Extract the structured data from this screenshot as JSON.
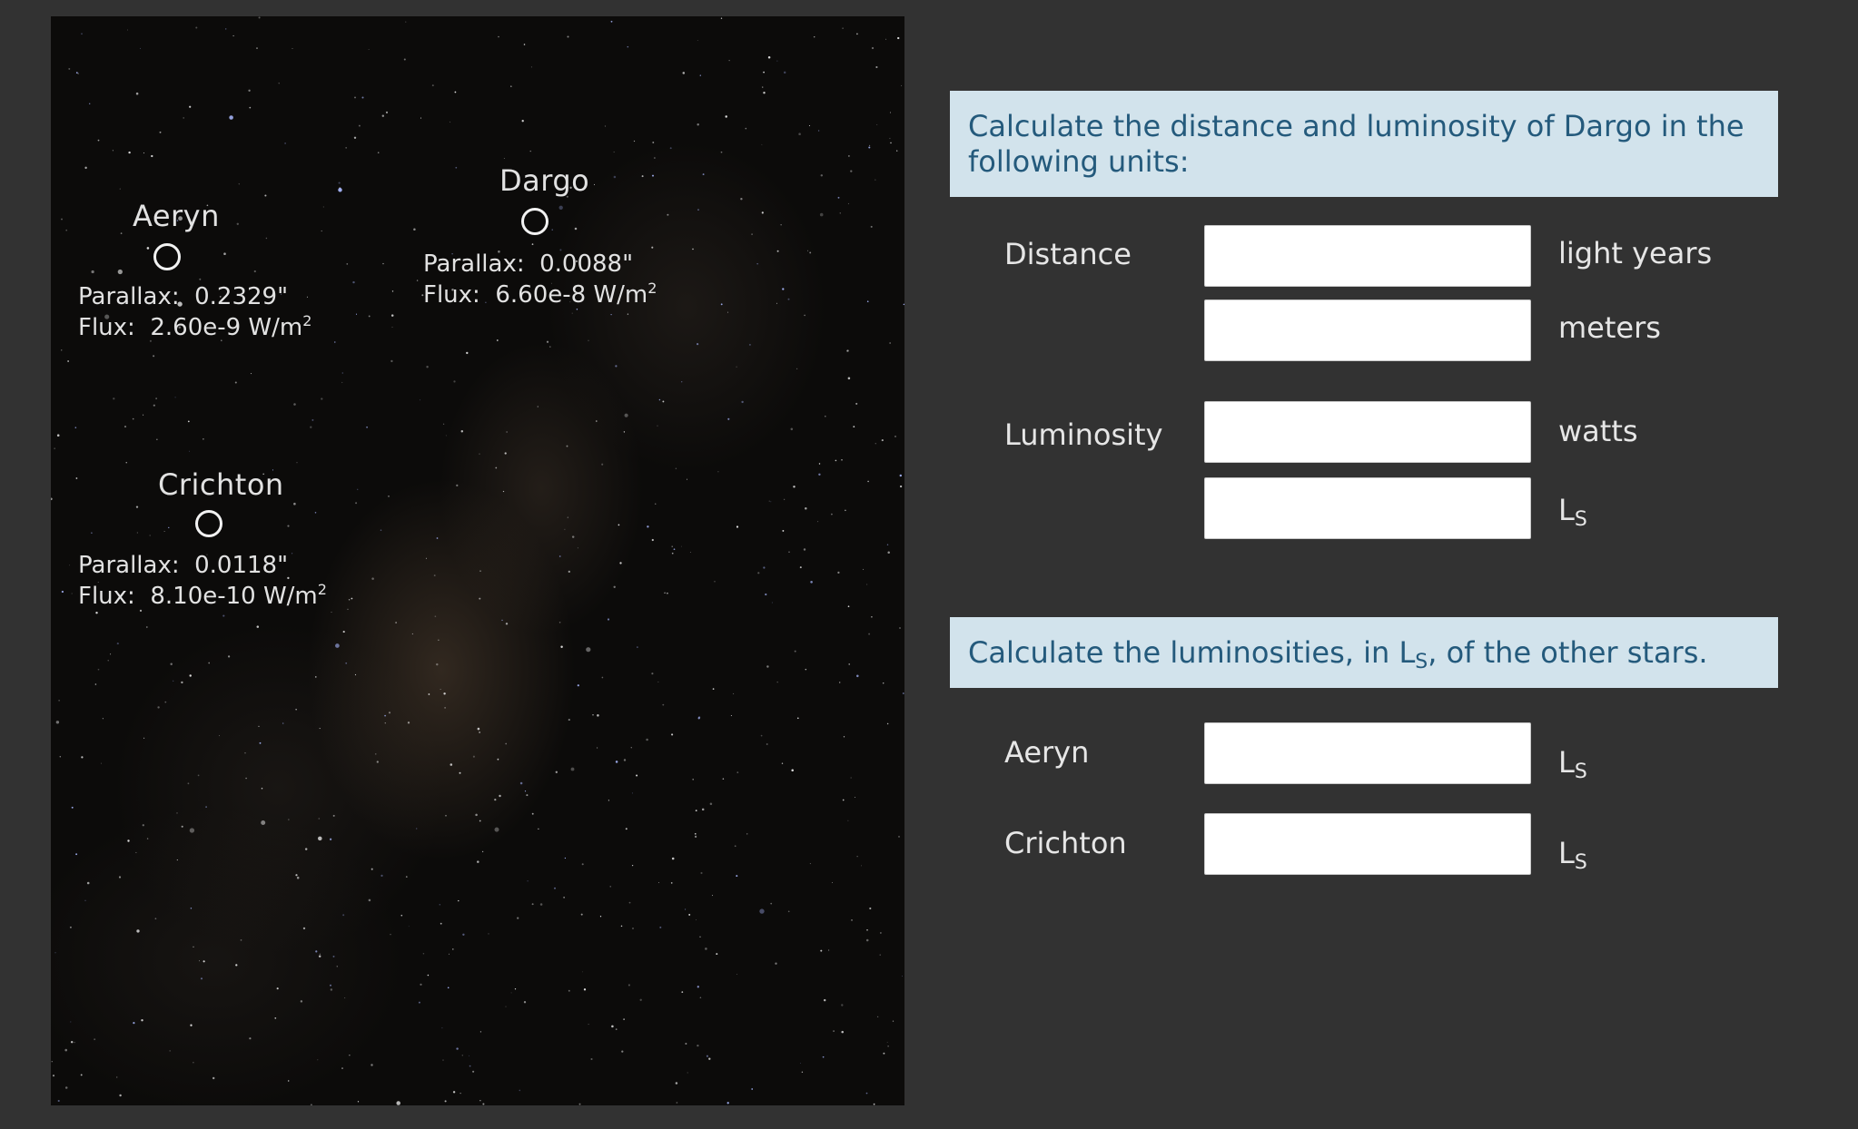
{
  "stars": [
    {
      "name": "Aeryn",
      "parallax_label": "Parallax:",
      "parallax_value": "0.2329\"",
      "flux_label": "Flux:",
      "flux_value": "2.60e-9 W/m",
      "flux_exponent": "2"
    },
    {
      "name": "Dargo",
      "parallax_label": "Parallax:",
      "parallax_value": "0.0088\"",
      "flux_label": "Flux:",
      "flux_value": "6.60e-8 W/m",
      "flux_exponent": "2"
    },
    {
      "name": "Crichton",
      "parallax_label": "Parallax:",
      "parallax_value": "0.0118\"",
      "flux_label": "Flux:",
      "flux_value": "8.10e-10 W/m",
      "flux_exponent": "2"
    }
  ],
  "section1": {
    "prompt": "Calculate the distance and luminosity of Dargo in the following units:",
    "distance_label": "Distance",
    "luminosity_label": "Luminosity",
    "fields": [
      {
        "value": "",
        "unit": "light years"
      },
      {
        "value": "",
        "unit": "meters"
      },
      {
        "value": "",
        "unit": "watts"
      },
      {
        "value": "",
        "unit_main": "L",
        "unit_sub": "S"
      }
    ]
  },
  "section2": {
    "prompt_before": "Calculate the luminosities, in L",
    "prompt_sub": "S",
    "prompt_after": ", of the other stars.",
    "rows": [
      {
        "label": "Aeryn",
        "value": "",
        "unit_main": "L",
        "unit_sub": "S"
      },
      {
        "label": "Crichton",
        "value": "",
        "unit_main": "L",
        "unit_sub": "S"
      }
    ]
  },
  "colors": {
    "page_background": "#323232",
    "prompt_background": "#d2e3ec",
    "prompt_text": "#245a7c",
    "label_text": "#e6e6e6",
    "sky": "#0c0b0a"
  }
}
